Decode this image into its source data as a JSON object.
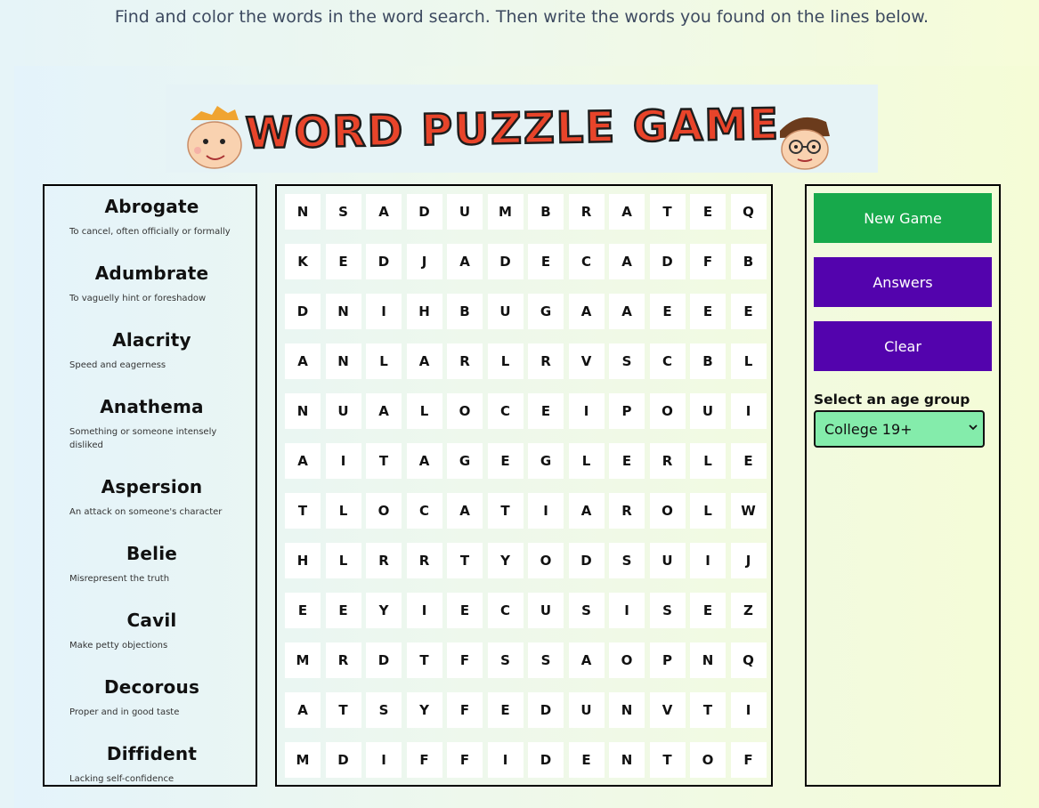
{
  "instructions": "Find and color the words in the word search. Then write the words you found on the lines below.",
  "logo": {
    "text": "WORD PUZZLE GAME"
  },
  "words": [
    {
      "word": "Abrogate",
      "definition": "To cancel, often officially or formally"
    },
    {
      "word": "Adumbrate",
      "definition": "To vaguelly hint or foreshadow"
    },
    {
      "word": "Alacrity",
      "definition": "Speed and eagerness"
    },
    {
      "word": "Anathema",
      "definition": "Something or someone intensely disliked"
    },
    {
      "word": "Aspersion",
      "definition": "An attack on someone's character"
    },
    {
      "word": "Belie",
      "definition": "Misrepresent the truth"
    },
    {
      "word": "Cavil",
      "definition": "Make petty objections"
    },
    {
      "word": "Decorous",
      "definition": "Proper and in good taste"
    },
    {
      "word": "Diffident",
      "definition": "Lacking self-confidence"
    }
  ],
  "grid": [
    [
      "N",
      "S",
      "A",
      "D",
      "U",
      "M",
      "B",
      "R",
      "A",
      "T",
      "E",
      "Q"
    ],
    [
      "K",
      "E",
      "D",
      "J",
      "A",
      "D",
      "E",
      "C",
      "A",
      "D",
      "F",
      "B"
    ],
    [
      "D",
      "N",
      "I",
      "H",
      "B",
      "U",
      "G",
      "A",
      "A",
      "E",
      "E",
      "E"
    ],
    [
      "A",
      "N",
      "L",
      "A",
      "R",
      "L",
      "R",
      "V",
      "S",
      "C",
      "B",
      "L"
    ],
    [
      "N",
      "U",
      "A",
      "L",
      "O",
      "C",
      "E",
      "I",
      "P",
      "O",
      "U",
      "I"
    ],
    [
      "A",
      "I",
      "T",
      "A",
      "G",
      "E",
      "G",
      "L",
      "E",
      "R",
      "L",
      "E"
    ],
    [
      "T",
      "L",
      "O",
      "C",
      "A",
      "T",
      "I",
      "A",
      "R",
      "O",
      "L",
      "W"
    ],
    [
      "H",
      "L",
      "R",
      "R",
      "T",
      "Y",
      "O",
      "D",
      "S",
      "U",
      "I",
      "J"
    ],
    [
      "E",
      "E",
      "Y",
      "I",
      "E",
      "C",
      "U",
      "S",
      "I",
      "S",
      "E",
      "Z"
    ],
    [
      "M",
      "R",
      "D",
      "T",
      "F",
      "S",
      "S",
      "A",
      "O",
      "P",
      "N",
      "Q"
    ],
    [
      "A",
      "T",
      "S",
      "Y",
      "F",
      "E",
      "D",
      "U",
      "N",
      "V",
      "T",
      "I"
    ],
    [
      "M",
      "D",
      "I",
      "F",
      "F",
      "I",
      "D",
      "E",
      "N",
      "T",
      "O",
      "F"
    ]
  ],
  "controls": {
    "new_game": "New Game",
    "answers": "Answers",
    "clear": "Clear",
    "age_label": "Select an age group",
    "age_selected": "College 19+"
  },
  "colors": {
    "new_game": "#17a94b",
    "answers": "#5303ad",
    "clear": "#5303ad",
    "select_bg": "#84ecab"
  }
}
